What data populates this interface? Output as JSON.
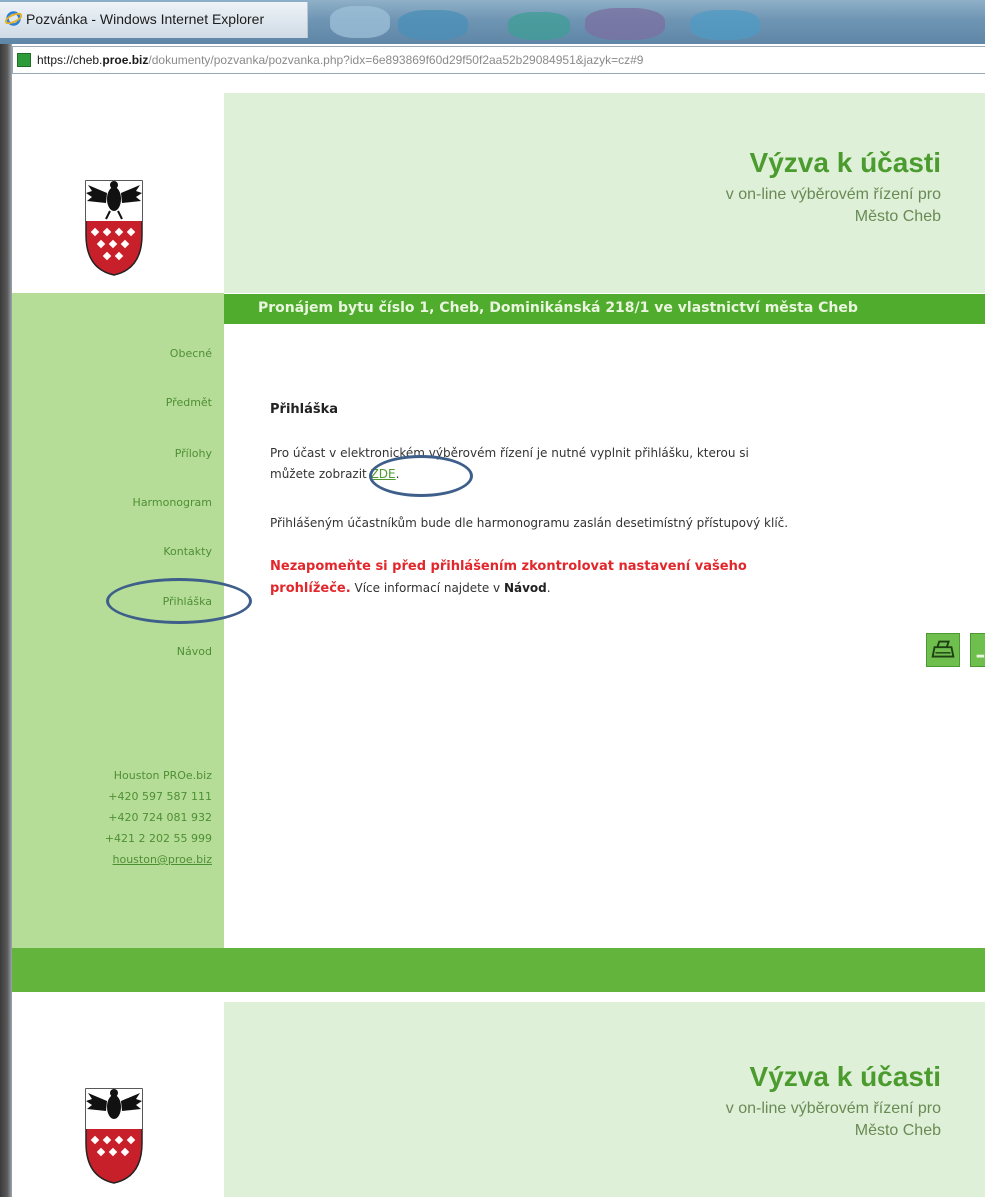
{
  "window": {
    "title": "Pozvánka - Windows Internet Explorer",
    "url_prefix": "https://cheb.",
    "url_domain": "proe.biz",
    "url_rest": "/dokumenty/pozvanka/pozvanka.php?idx=6e893869f60d29f50f2aa52b29084951&jazyk=cz#9"
  },
  "header": {
    "title": "Výzva k účasti",
    "subtitle_line1": "v on-line výběrovém řízení pro",
    "subtitle_line2": "Město Cheb"
  },
  "banner": {
    "text": "Pronájem bytu číslo 1, Cheb, Dominikánská 218/1 ve vlastnictví města Cheb"
  },
  "nav": {
    "items": [
      "Obecné",
      "Předmět",
      "Přílohy",
      "Harmonogram",
      "Kontakty",
      "Přihláška",
      "Návod"
    ]
  },
  "contact": {
    "name": "Houston PROe.biz",
    "phone1": "+420 597 587 111",
    "phone2": "+420 724 081 932",
    "phone3": "+421 2 202 55 999",
    "email": "houston@proe.biz"
  },
  "content": {
    "heading": "Přihláška",
    "para1_line1": "Pro účast v elektronickém výběrovém řízení je nutné vyplnit přihlášku, kterou si",
    "para1_line2_pre": "můžete zobrazit ",
    "para1_link": "ZDE",
    "para1_line2_post": ".",
    "para2": "Přihlášeným účastníkům bude dle harmonogramu zaslán desetimístný přístupový klíč.",
    "warn_line1": "Nezapomeňte si před přihlášením zkontrolovat nastavení vašeho",
    "warn_line2": "prohlížeče.",
    "info_pre": " Více informací najdete v ",
    "info_bold": "Návod",
    "info_post": "."
  },
  "colors": {
    "brand_green": "#4fac2c",
    "sidebar_green": "#b5dd97",
    "header_green": "#dff0d8",
    "warning_red": "#e2272c",
    "annotation_blue": "#3d5f8a"
  },
  "icons": {
    "print": "print-icon",
    "save": "save-icon"
  }
}
